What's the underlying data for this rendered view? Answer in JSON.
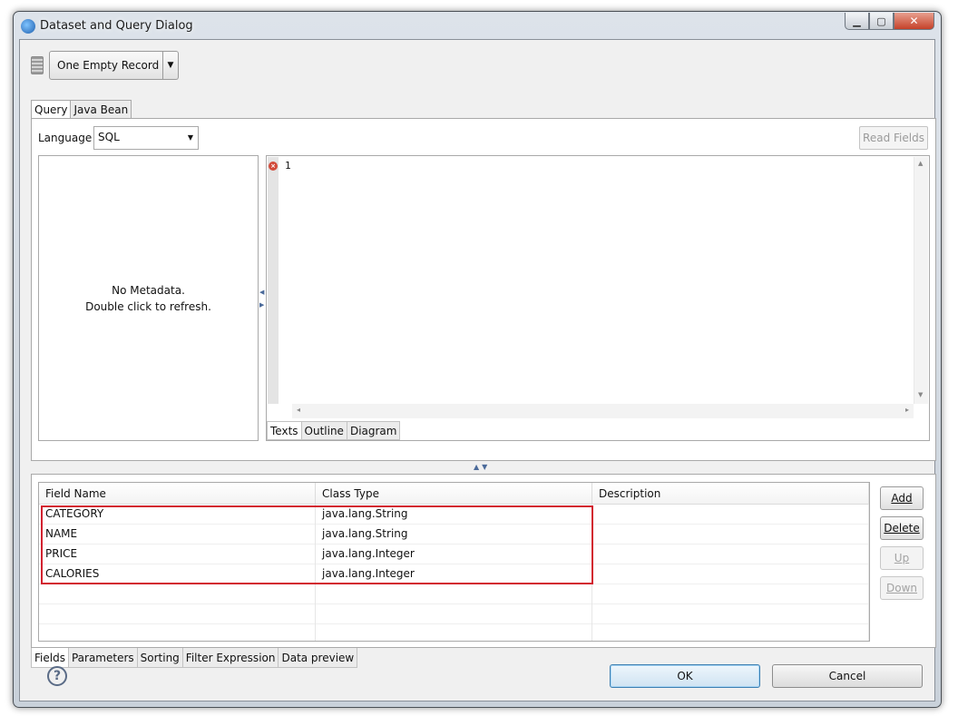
{
  "window": {
    "title": "Dataset and Query Dialog",
    "min_glyph": "▁",
    "max_glyph": "▢",
    "close_glyph": "✕"
  },
  "toolbar": {
    "data_source": "One Empty Record",
    "dropdown_glyph": "▼"
  },
  "query_tabs": [
    {
      "label": "Query",
      "active": true
    },
    {
      "label": "Java Bean",
      "active": false
    }
  ],
  "query": {
    "language_label": "Language",
    "language_value": "SQL",
    "read_fields_label": "Read Fields",
    "metadata_line1": "No Metadata.",
    "metadata_line2": "Double click to refresh.",
    "line_number": "1",
    "error_glyph": "×"
  },
  "editor_tabs": [
    {
      "label": "Texts",
      "active": true
    },
    {
      "label": "Outline",
      "active": false
    },
    {
      "label": "Diagram",
      "active": false
    }
  ],
  "fields_table": {
    "columns": [
      "Field Name",
      "Class Type",
      "Description"
    ],
    "rows": [
      {
        "name": "CATEGORY",
        "type": "java.lang.String",
        "desc": ""
      },
      {
        "name": "NAME",
        "type": "java.lang.String",
        "desc": ""
      },
      {
        "name": "PRICE",
        "type": "java.lang.Integer",
        "desc": ""
      },
      {
        "name": "CALORIES",
        "type": "java.lang.Integer",
        "desc": ""
      }
    ],
    "highlight_color": "#d2202f"
  },
  "field_buttons": {
    "add": "Add",
    "delete": "Delete",
    "up": "Up",
    "down": "Down"
  },
  "bottom_tabs": [
    {
      "label": "Fields",
      "active": true
    },
    {
      "label": "Parameters",
      "active": false
    },
    {
      "label": "Sorting",
      "active": false
    },
    {
      "label": "Filter Expression",
      "active": false
    },
    {
      "label": "Data preview",
      "active": false
    }
  ],
  "dialog": {
    "help_glyph": "?",
    "ok": "OK",
    "cancel": "Cancel"
  }
}
